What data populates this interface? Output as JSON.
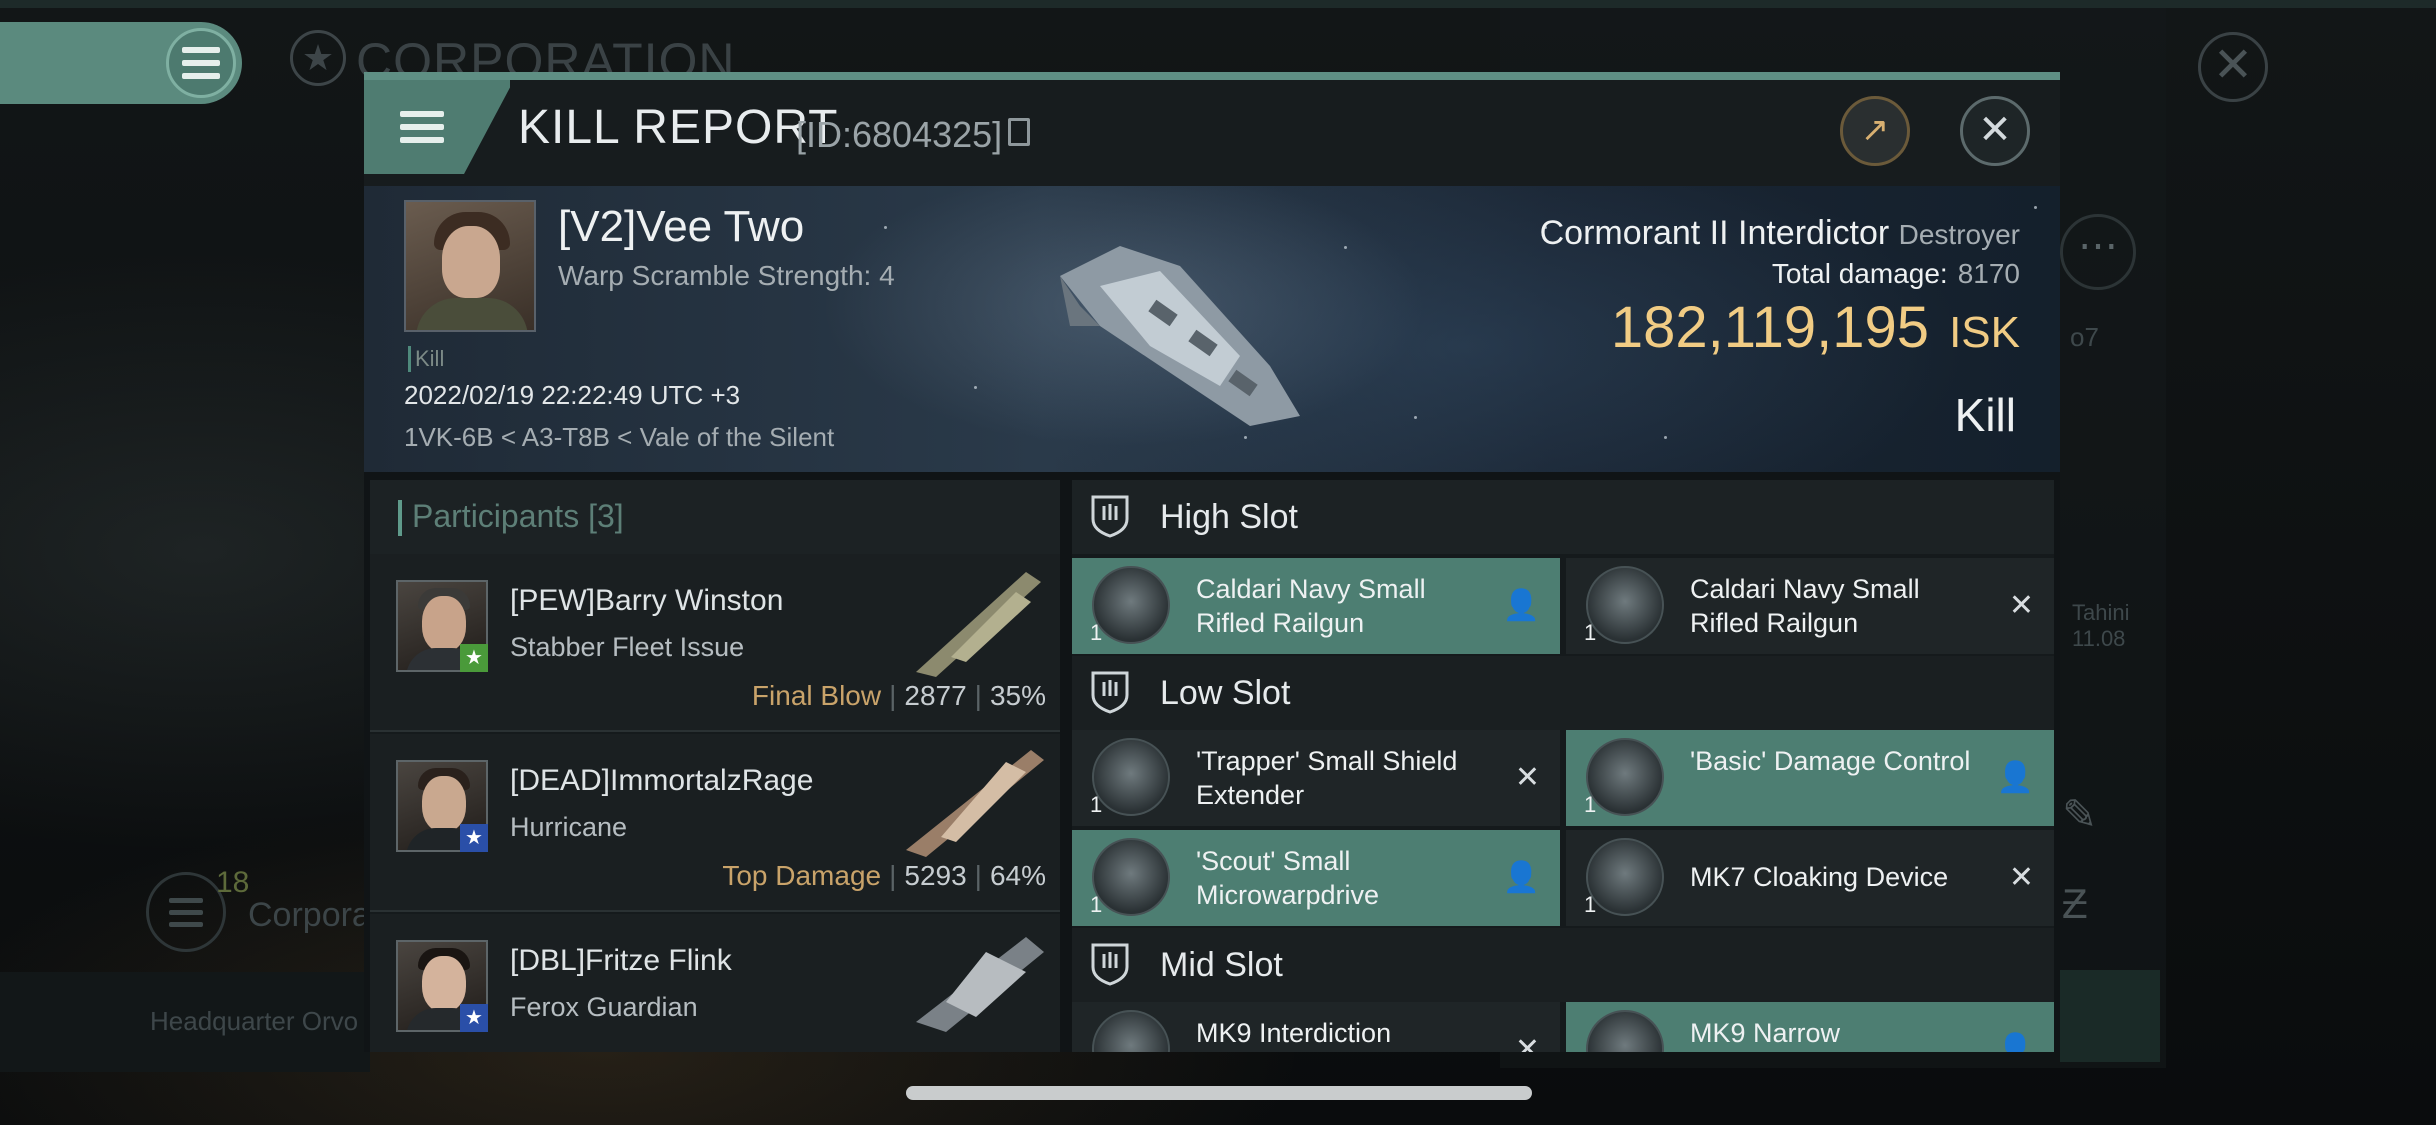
{
  "background": {
    "title": "CORPORATION",
    "corp_count": "18",
    "corp_label": "Corpora",
    "hq_label": "Headquarter Orvo",
    "side_text_a": "o7",
    "side_text_b": "Tahini",
    "side_text_c": "11.08"
  },
  "modal": {
    "title": "KILL REPORT",
    "report_id": "[ID:6804325]"
  },
  "victim": {
    "name": "[V2]Vee Two",
    "subtitle": "Warp Scramble Strength: 4",
    "tag": "Kill",
    "datetime": "2022/02/19 22:22:49 UTC +3",
    "location": "1VK-6B < A3-T8B < Vale of the Silent",
    "ship_name": "Cormorant II Interdictor",
    "ship_class": "Destroyer",
    "total_damage_label": "Total damage:",
    "total_damage": "8170",
    "isk_value": "182,119,195",
    "isk_unit": "ISK",
    "result": "Kill"
  },
  "participants": {
    "label": "Participants",
    "count": "[3]",
    "rows": [
      {
        "name": "[PEW]Barry Winston",
        "ship": "Stabber Fleet Issue",
        "tag": "Final Blow",
        "damage": "2877",
        "percent": "35%",
        "badge": "★",
        "badge_color": "#4a9a3a"
      },
      {
        "name": "[DEAD]ImmortalzRage",
        "ship": "Hurricane",
        "tag": "Top Damage",
        "damage": "5293",
        "percent": "64%",
        "badge": "★",
        "badge_color": "#2a4fa8"
      },
      {
        "name": "[DBL]Fritze Flink",
        "ship": "Ferox Guardian",
        "tag": "",
        "damage": "",
        "percent": "",
        "badge": "★",
        "badge_color": "#2a4fa8"
      }
    ]
  },
  "slots": {
    "high": {
      "title": "High Slot",
      "items": [
        {
          "name": "Caldari Navy Small Rifled Railgun",
          "qty": "1",
          "state": "fitted"
        },
        {
          "name": "Caldari Navy Small Rifled Railgun",
          "qty": "1",
          "state": "destroyed"
        }
      ]
    },
    "low": {
      "title": "Low Slot",
      "items": [
        {
          "name": "'Trapper' Small Shield Extender",
          "qty": "1",
          "state": "destroyed"
        },
        {
          "name": "'Basic' Damage Control",
          "qty": "1",
          "state": "fitted"
        },
        {
          "name": "'Scout' Small Microwarpdrive",
          "qty": "1",
          "state": "fitted"
        },
        {
          "name": "MK7 Cloaking Device",
          "qty": "1",
          "state": "destroyed"
        }
      ]
    },
    "mid": {
      "title": "Mid Slot",
      "items": [
        {
          "name": "MK9 Interdiction",
          "qty": "1",
          "state": "destroyed"
        },
        {
          "name": "MK9 Narrow",
          "qty": "1",
          "state": "fitted"
        }
      ]
    }
  },
  "colors": {
    "accent": "#5f8f84",
    "isk": "#f1cc84",
    "fitted": "#4d7e72",
    "destroyed": "#1f2527"
  }
}
